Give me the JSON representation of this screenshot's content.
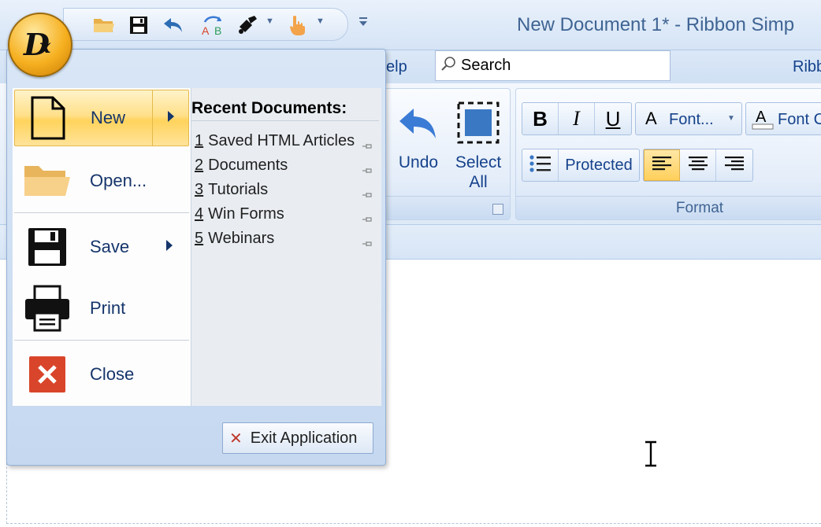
{
  "window": {
    "title": "New Document 1* - Ribbon Simp",
    "app_orb_letter": "D",
    "app_orb_sub": "x"
  },
  "quick_access": {
    "items": [
      {
        "icon": "open-folder-icon"
      },
      {
        "icon": "save-icon"
      },
      {
        "icon": "undo-icon"
      },
      {
        "icon": "spell-check-icon"
      },
      {
        "icon": "paint-icon"
      },
      {
        "icon": "touch-hand-icon"
      }
    ]
  },
  "tabs": {
    "help": "elp",
    "right_partial": "Ribb"
  },
  "search": {
    "placeholder": "Search"
  },
  "ribbon": {
    "edit_group": {
      "undo_label": "Undo",
      "select_all_line1": "Select",
      "select_all_line2": "All"
    },
    "format_group": {
      "label": "Format",
      "bold": "B",
      "italic": "I",
      "underline": "U",
      "font_label": "Font...",
      "font_color_label": "Font C",
      "protected_label": "Protected",
      "align_left_selected": true
    }
  },
  "app_menu": {
    "items": [
      {
        "label": "New",
        "icon": "new-document-icon",
        "has_submenu": true,
        "highlighted": true
      },
      {
        "label": "Open...",
        "icon": "open-folder-icon"
      },
      {
        "label": "Save",
        "icon": "save-icon",
        "has_submenu": true
      },
      {
        "label": "Print",
        "icon": "print-icon"
      },
      {
        "label": "Close",
        "icon": "close-icon"
      }
    ],
    "recent_title": "Recent Documents:",
    "recent": [
      {
        "num": "1",
        "name": "Saved HTML Articles"
      },
      {
        "num": "2",
        "name": "Documents"
      },
      {
        "num": "3",
        "name": "Tutorials"
      },
      {
        "num": "4",
        "name": "Win Forms"
      },
      {
        "num": "5",
        "name": "Webinars"
      }
    ],
    "exit_label": "Exit Application"
  },
  "colors": {
    "accent_text": "#15428b",
    "highlight": "#ffd35c",
    "close_red": "#d9452b"
  }
}
